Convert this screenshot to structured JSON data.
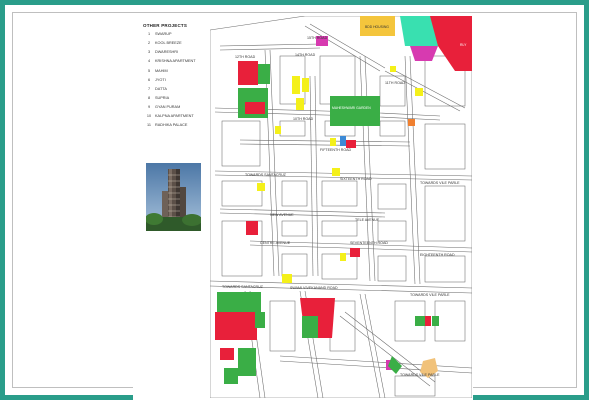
{
  "legend": {
    "title": "OTHER PROJECTS",
    "items": [
      {
        "num": "1",
        "label": "SWARUP"
      },
      {
        "num": "2",
        "label": "KOOL BREEZE"
      },
      {
        "num": "3",
        "label": "DWARESHRI"
      },
      {
        "num": "4",
        "label": "KRISHNA APARTMENT"
      },
      {
        "num": "5",
        "label": "MAHIM"
      },
      {
        "num": "6",
        "label": "JYOTI"
      },
      {
        "num": "7",
        "label": "DATTA"
      },
      {
        "num": "8",
        "label": "SUPRIA"
      },
      {
        "num": "9",
        "label": "GYAN PURAM"
      },
      {
        "num": "10",
        "label": "KALPNA APARTMENT"
      },
      {
        "num": "11",
        "label": "RADHIKA PALACE"
      }
    ]
  },
  "map_labels": {
    "top_road": "15TH ROAD",
    "road_a": "14TH ROAD",
    "road_b": "12TH ROAD",
    "road_c": "10TH ROAD",
    "road_d": "11TH ROAD",
    "road_e": "FIFTEENTH ROAD",
    "road_f": "SIXTEENTH ROAD",
    "road_g": "SEVENTEENTH ROAD",
    "road_h": "EIGHTEENTH ROAD",
    "road_i": "NEW AVENUE",
    "road_j": "CENTRE AVENUE",
    "road_k": "TELE AVENUE",
    "road_l": "SWAMI VIVEKANAND ROAD",
    "road_m": "TOWARDS SANTACRUZ",
    "road_n": "TOWARDS VILE PARLE",
    "garden": "MAHESHWARI GARDEN",
    "housing": "BDD HOUSING",
    "rly": "RLY",
    "compass_n": "N",
    "compass_s": "S",
    "compass_e": "E",
    "compass_w": "W"
  },
  "colors": {
    "border": "#2a9d8a",
    "green": "#3aae46",
    "red": "#e8203a",
    "yellow": "#f4f01a",
    "magenta": "#d73ab0",
    "teal": "#39e0b0",
    "blue": "#3c8ad6",
    "orange": "#f08030",
    "tan": "#f1c27a"
  }
}
